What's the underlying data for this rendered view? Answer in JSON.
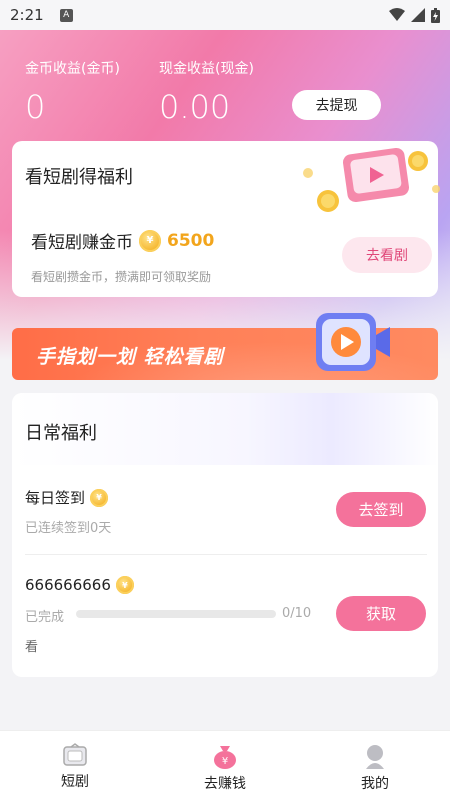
{
  "status": {
    "time": "2:21",
    "notif_letter": "A"
  },
  "earnings": {
    "coin_label": "金币收益(金币)",
    "coin_value": "0",
    "cash_label": "现金收益(现金)",
    "cash_value": "0.00",
    "withdraw_label": "去提现"
  },
  "drama_card": {
    "title": "看短剧得福利",
    "subtitle": "看短剧赚金币",
    "coin_amount": "6500",
    "description": "看短剧攒金币，攒满即可领取奖励",
    "button_label": "去看剧"
  },
  "banner": {
    "text": "手指划一划 轻松看剧"
  },
  "daily": {
    "title": "日常福利",
    "tasks": [
      {
        "name": "每日签到",
        "sub": "已连续签到0天",
        "button": "去签到"
      },
      {
        "name": "666666666",
        "sub": "已完成",
        "progress": "0/10",
        "progress_fraction": 0,
        "extra": "看",
        "button": "获取"
      }
    ]
  },
  "nav": {
    "items": [
      {
        "label": "短剧",
        "icon": "tv-icon"
      },
      {
        "label": "去赚钱",
        "icon": "money-bag-icon"
      },
      {
        "label": "我的",
        "icon": "user-icon"
      }
    ]
  },
  "colors": {
    "accent_pink": "#f4729b",
    "coin_gold": "#f2a51c",
    "banner_orange": "#ff7a52"
  }
}
